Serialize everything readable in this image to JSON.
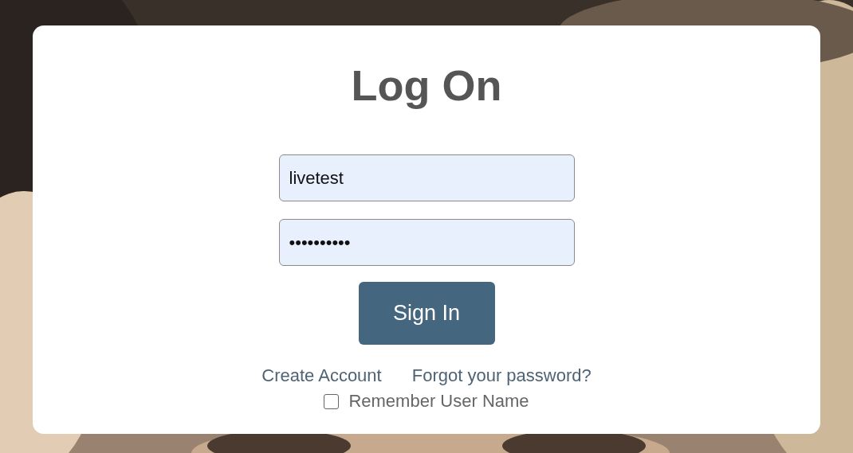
{
  "title": "Log On",
  "username": {
    "value": "livetest"
  },
  "password": {
    "value": "••••••••••"
  },
  "sign_in_button": "Sign In",
  "links": [
    {
      "label": "Create Account"
    },
    {
      "label": "Forgot your password?"
    }
  ],
  "remember": {
    "label": "Remember User Name",
    "checked": false
  }
}
